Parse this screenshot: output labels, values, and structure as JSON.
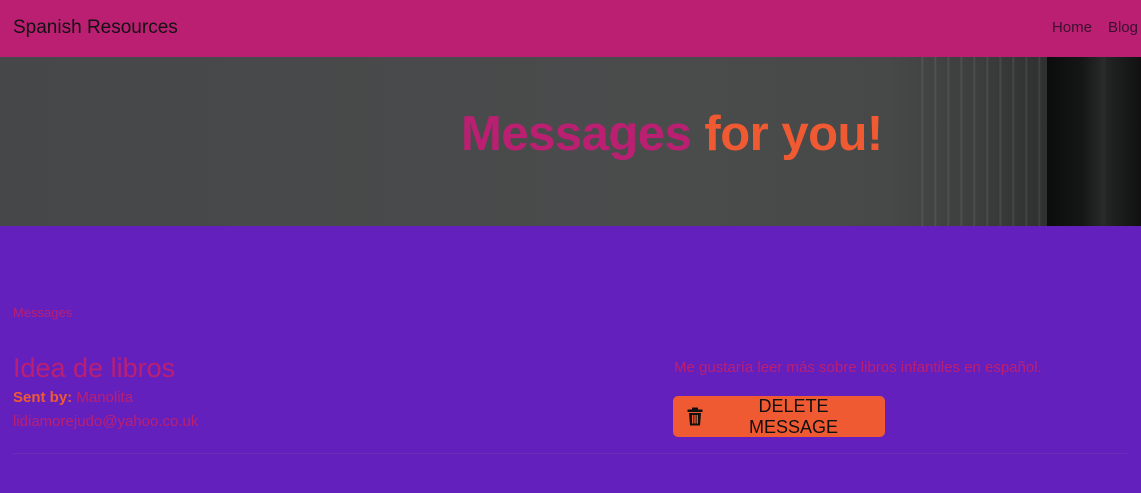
{
  "navbar": {
    "brand": "Spanish Resources",
    "links": [
      "Home",
      "Blog"
    ]
  },
  "hero": {
    "title_part1": "Messages",
    "title_part2": "for you!"
  },
  "messages": {
    "section_label": "Messages",
    "items": [
      {
        "title": "Idea de libros",
        "sent_by_label": "Sent by:",
        "sender": "Manolita",
        "email": "lidiamorejudo@yahoo.co.uk",
        "body": "Me gustaría leer más sobre libros infantiles en español.",
        "delete_label": "DELETE MESSAGE",
        "delete_icon": "trash-icon"
      }
    ]
  },
  "colors": {
    "navbar": "#bb1f72",
    "background": "#6320bd",
    "accent": "#f05a32",
    "text_pink": "#bb1f72"
  }
}
